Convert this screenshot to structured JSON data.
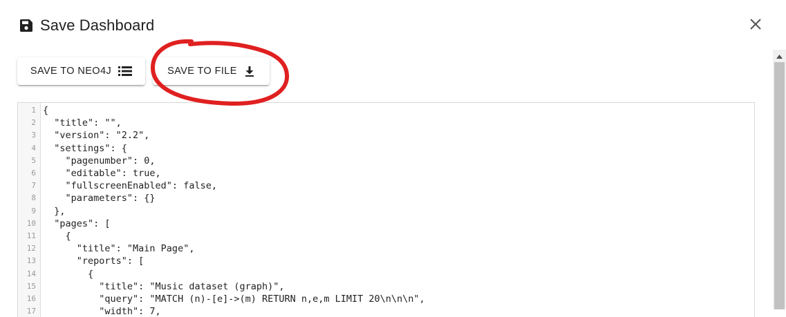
{
  "dialog": {
    "title": "Save Dashboard",
    "close_symbol": "✕",
    "save_icon": "floppy-disk-icon",
    "close_icon": "close-icon"
  },
  "buttons": {
    "save_to_neo4j": {
      "label": "SAVE TO NEO4J",
      "icon": "storage-list-icon"
    },
    "save_to_file": {
      "label": "SAVE TO FILE",
      "icon": "download-icon"
    }
  },
  "editor": {
    "lines": [
      {
        "number": "1",
        "text": "{"
      },
      {
        "number": "2",
        "text": "  \"title\": \"\","
      },
      {
        "number": "3",
        "text": "  \"version\": \"2.2\","
      },
      {
        "number": "4",
        "text": "  \"settings\": {"
      },
      {
        "number": "5",
        "text": "    \"pagenumber\": 0,"
      },
      {
        "number": "6",
        "text": "    \"editable\": true,"
      },
      {
        "number": "7",
        "text": "    \"fullscreenEnabled\": false,"
      },
      {
        "number": "8",
        "text": "    \"parameters\": {}"
      },
      {
        "number": "9",
        "text": "  },"
      },
      {
        "number": "10",
        "text": "  \"pages\": ["
      },
      {
        "number": "11",
        "text": "    {"
      },
      {
        "number": "12",
        "text": "      \"title\": \"Main Page\","
      },
      {
        "number": "13",
        "text": "      \"reports\": ["
      },
      {
        "number": "14",
        "text": "        {"
      },
      {
        "number": "15",
        "text": "          \"title\": \"Music dataset (graph)\","
      },
      {
        "number": "16",
        "text": "          \"query\": \"MATCH (n)-[e]->(m) RETURN n,e,m LIMIT 20\\n\\n\\n\","
      },
      {
        "number": "17",
        "text": "          \"width\": 7,"
      }
    ]
  },
  "colors": {
    "annotation_circle": "#e02020",
    "scrollbar_thumb": "#c1c1c1"
  }
}
